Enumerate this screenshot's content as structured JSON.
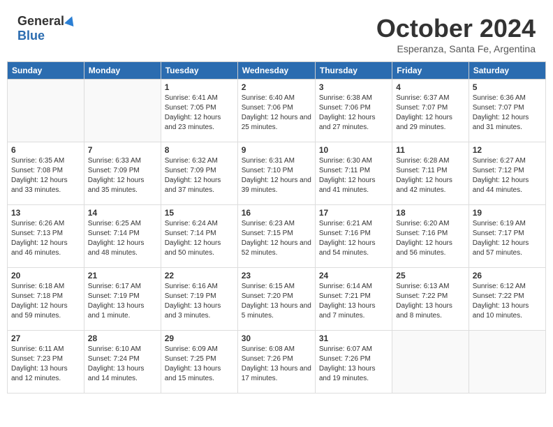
{
  "header": {
    "logo_text_general": "General",
    "logo_text_blue": "Blue",
    "month": "October 2024",
    "location": "Esperanza, Santa Fe, Argentina"
  },
  "days_of_week": [
    "Sunday",
    "Monday",
    "Tuesday",
    "Wednesday",
    "Thursday",
    "Friday",
    "Saturday"
  ],
  "weeks": [
    [
      {
        "day": "",
        "info": ""
      },
      {
        "day": "",
        "info": ""
      },
      {
        "day": "1",
        "info": "Sunrise: 6:41 AM\nSunset: 7:05 PM\nDaylight: 12 hours and 23 minutes."
      },
      {
        "day": "2",
        "info": "Sunrise: 6:40 AM\nSunset: 7:06 PM\nDaylight: 12 hours and 25 minutes."
      },
      {
        "day": "3",
        "info": "Sunrise: 6:38 AM\nSunset: 7:06 PM\nDaylight: 12 hours and 27 minutes."
      },
      {
        "day": "4",
        "info": "Sunrise: 6:37 AM\nSunset: 7:07 PM\nDaylight: 12 hours and 29 minutes."
      },
      {
        "day": "5",
        "info": "Sunrise: 6:36 AM\nSunset: 7:07 PM\nDaylight: 12 hours and 31 minutes."
      }
    ],
    [
      {
        "day": "6",
        "info": "Sunrise: 6:35 AM\nSunset: 7:08 PM\nDaylight: 12 hours and 33 minutes."
      },
      {
        "day": "7",
        "info": "Sunrise: 6:33 AM\nSunset: 7:09 PM\nDaylight: 12 hours and 35 minutes."
      },
      {
        "day": "8",
        "info": "Sunrise: 6:32 AM\nSunset: 7:09 PM\nDaylight: 12 hours and 37 minutes."
      },
      {
        "day": "9",
        "info": "Sunrise: 6:31 AM\nSunset: 7:10 PM\nDaylight: 12 hours and 39 minutes."
      },
      {
        "day": "10",
        "info": "Sunrise: 6:30 AM\nSunset: 7:11 PM\nDaylight: 12 hours and 41 minutes."
      },
      {
        "day": "11",
        "info": "Sunrise: 6:28 AM\nSunset: 7:11 PM\nDaylight: 12 hours and 42 minutes."
      },
      {
        "day": "12",
        "info": "Sunrise: 6:27 AM\nSunset: 7:12 PM\nDaylight: 12 hours and 44 minutes."
      }
    ],
    [
      {
        "day": "13",
        "info": "Sunrise: 6:26 AM\nSunset: 7:13 PM\nDaylight: 12 hours and 46 minutes."
      },
      {
        "day": "14",
        "info": "Sunrise: 6:25 AM\nSunset: 7:14 PM\nDaylight: 12 hours and 48 minutes."
      },
      {
        "day": "15",
        "info": "Sunrise: 6:24 AM\nSunset: 7:14 PM\nDaylight: 12 hours and 50 minutes."
      },
      {
        "day": "16",
        "info": "Sunrise: 6:23 AM\nSunset: 7:15 PM\nDaylight: 12 hours and 52 minutes."
      },
      {
        "day": "17",
        "info": "Sunrise: 6:21 AM\nSunset: 7:16 PM\nDaylight: 12 hours and 54 minutes."
      },
      {
        "day": "18",
        "info": "Sunrise: 6:20 AM\nSunset: 7:16 PM\nDaylight: 12 hours and 56 minutes."
      },
      {
        "day": "19",
        "info": "Sunrise: 6:19 AM\nSunset: 7:17 PM\nDaylight: 12 hours and 57 minutes."
      }
    ],
    [
      {
        "day": "20",
        "info": "Sunrise: 6:18 AM\nSunset: 7:18 PM\nDaylight: 12 hours and 59 minutes."
      },
      {
        "day": "21",
        "info": "Sunrise: 6:17 AM\nSunset: 7:19 PM\nDaylight: 13 hours and 1 minute."
      },
      {
        "day": "22",
        "info": "Sunrise: 6:16 AM\nSunset: 7:19 PM\nDaylight: 13 hours and 3 minutes."
      },
      {
        "day": "23",
        "info": "Sunrise: 6:15 AM\nSunset: 7:20 PM\nDaylight: 13 hours and 5 minutes."
      },
      {
        "day": "24",
        "info": "Sunrise: 6:14 AM\nSunset: 7:21 PM\nDaylight: 13 hours and 7 minutes."
      },
      {
        "day": "25",
        "info": "Sunrise: 6:13 AM\nSunset: 7:22 PM\nDaylight: 13 hours and 8 minutes."
      },
      {
        "day": "26",
        "info": "Sunrise: 6:12 AM\nSunset: 7:22 PM\nDaylight: 13 hours and 10 minutes."
      }
    ],
    [
      {
        "day": "27",
        "info": "Sunrise: 6:11 AM\nSunset: 7:23 PM\nDaylight: 13 hours and 12 minutes."
      },
      {
        "day": "28",
        "info": "Sunrise: 6:10 AM\nSunset: 7:24 PM\nDaylight: 13 hours and 14 minutes."
      },
      {
        "day": "29",
        "info": "Sunrise: 6:09 AM\nSunset: 7:25 PM\nDaylight: 13 hours and 15 minutes."
      },
      {
        "day": "30",
        "info": "Sunrise: 6:08 AM\nSunset: 7:26 PM\nDaylight: 13 hours and 17 minutes."
      },
      {
        "day": "31",
        "info": "Sunrise: 6:07 AM\nSunset: 7:26 PM\nDaylight: 13 hours and 19 minutes."
      },
      {
        "day": "",
        "info": ""
      },
      {
        "day": "",
        "info": ""
      }
    ]
  ]
}
